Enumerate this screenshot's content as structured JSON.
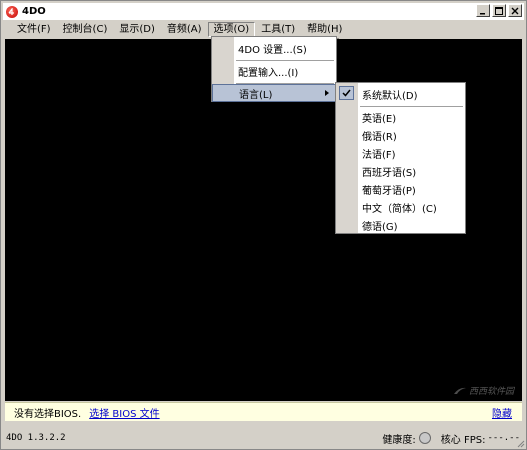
{
  "window": {
    "title": "4DO",
    "icon": "4do-logo-icon",
    "controls": [
      "minimize-icon",
      "maximize-icon",
      "close-icon"
    ]
  },
  "menubar": {
    "items": [
      {
        "label": "文件(F)"
      },
      {
        "label": "控制台(C)"
      },
      {
        "label": "显示(D)"
      },
      {
        "label": "音频(A)"
      },
      {
        "label": "选项(O)",
        "active": true
      },
      {
        "label": "工具(T)"
      },
      {
        "label": "帮助(H)"
      }
    ]
  },
  "options_menu": {
    "items": [
      {
        "label": "4DO 设置...(S)"
      },
      {
        "label": "配置输入...(I)"
      },
      {
        "label": "语言(L)",
        "submenu": true,
        "highlighted": true
      }
    ]
  },
  "language_menu": {
    "default": {
      "label": "系统默认(D)",
      "checked": true
    },
    "languages": [
      {
        "label": "英语(E)"
      },
      {
        "label": "俄语(R)"
      },
      {
        "label": "法语(F)"
      },
      {
        "label": "西班牙语(S)"
      },
      {
        "label": "葡萄牙语(P)"
      },
      {
        "label": "中文（简体）(C)"
      },
      {
        "label": "德语(G)"
      }
    ]
  },
  "notification": {
    "message": "没有选择BIOS.",
    "link": "选择 BIOS 文件",
    "hide": "隐藏"
  },
  "status": {
    "version": "4DO 1.3.2.2",
    "health_label": "健康度:",
    "core_label": "核心 FPS:",
    "fps_value": "---.--"
  },
  "watermark": {
    "text": "西西软件园"
  },
  "colors": {
    "window_bg": "#d4d0c8",
    "display_bg": "#000000",
    "notification_bg": "#ffffe1",
    "link": "#0000cc",
    "menu_highlight": "#b8c3d6"
  }
}
